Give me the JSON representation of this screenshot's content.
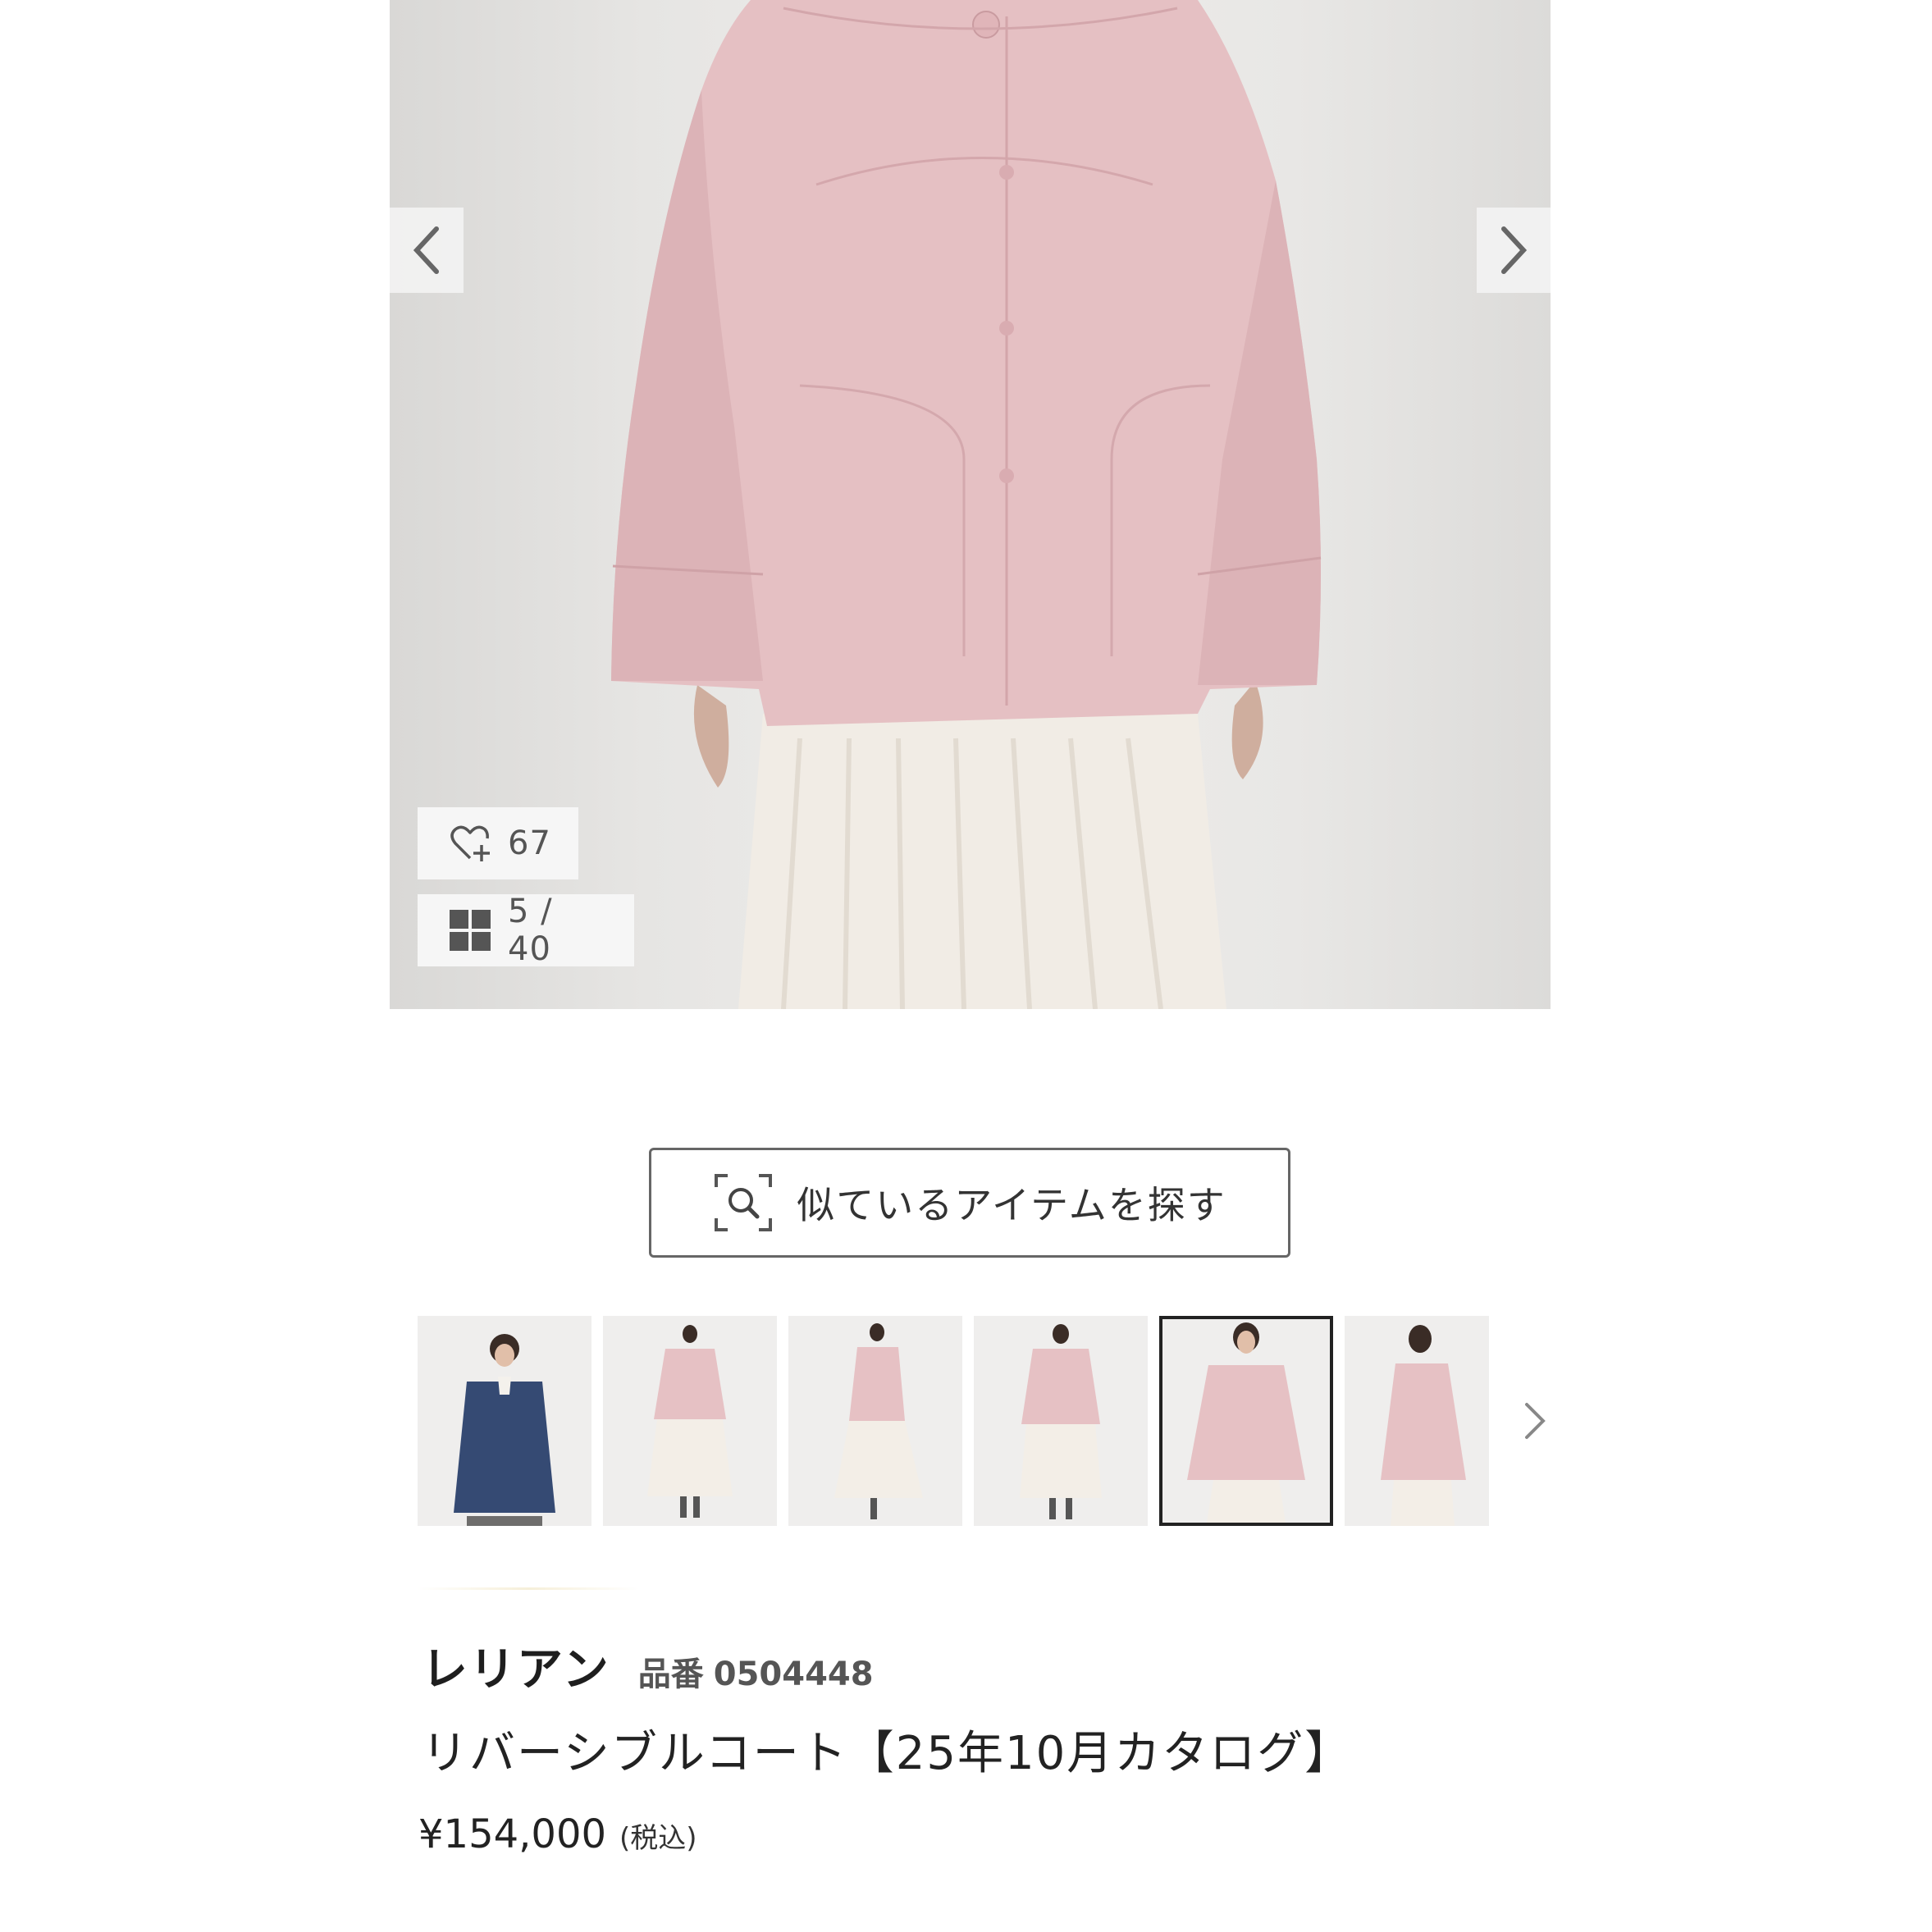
{
  "gallery": {
    "favorite_count": "67",
    "image_counter": "5 / 40",
    "icons": {
      "prev": "chevron-left-icon",
      "next": "chevron-right-icon",
      "favorite": "heart-plus-icon",
      "grid": "grid-icon"
    }
  },
  "similar_search": {
    "label": "似ているアイテムを探す",
    "icon": "image-search-icon"
  },
  "thumbnails": {
    "selected_index": 4,
    "items": [
      {
        "color": "navy"
      },
      {
        "color": "pink"
      },
      {
        "color": "pink"
      },
      {
        "color": "pink"
      },
      {
        "color": "pink"
      },
      {
        "color": "pink"
      }
    ]
  },
  "product": {
    "brand": "レリアン",
    "sku_label": "品番",
    "sku": "0504448",
    "name": "リバーシブルコート【25年10月カタログ】",
    "price": "¥154,000",
    "tax_note": "(税込)"
  },
  "colors": {
    "coat_pink": "#e6c1c4",
    "coat_navy": "#354a73",
    "skirt_cream": "#f2ede6",
    "background": "#ecebe9"
  }
}
